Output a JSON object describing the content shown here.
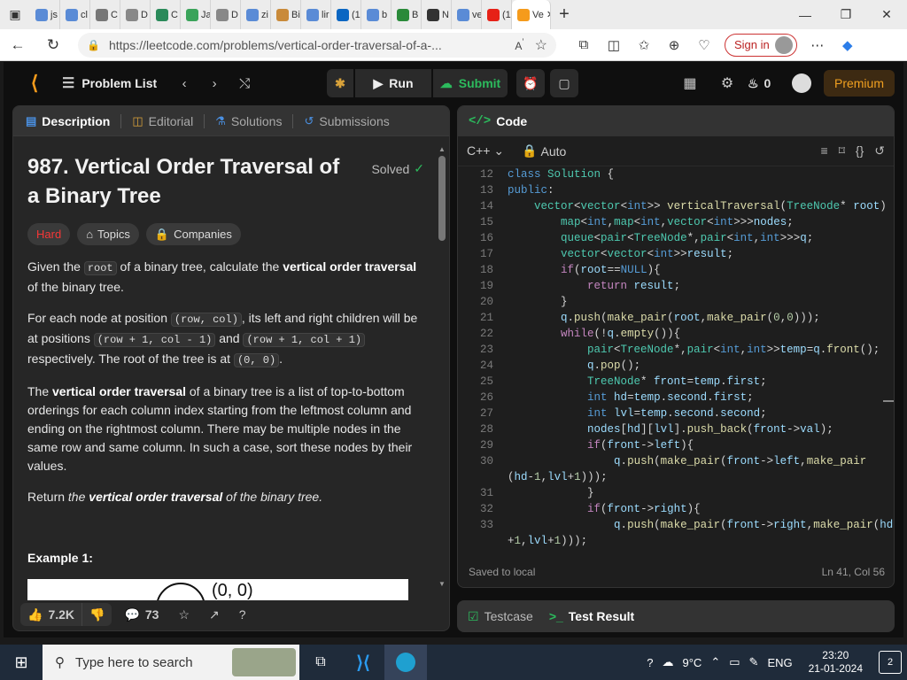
{
  "browser": {
    "tabs": [
      {
        "label": "js",
        "color": "#5a8bd6"
      },
      {
        "label": "cl",
        "color": "#5a8bd6"
      },
      {
        "label": "C",
        "color": "#777777"
      },
      {
        "label": "D",
        "color": "#888888"
      },
      {
        "label": "C",
        "color": "#2a8a5a"
      },
      {
        "label": "Ja",
        "color": "#3aa35a"
      },
      {
        "label": "D",
        "color": "#888888"
      },
      {
        "label": "zi",
        "color": "#5a8bd6"
      },
      {
        "label": "Bi",
        "color": "#c98a3a"
      },
      {
        "label": "lir",
        "color": "#5a8bd6"
      },
      {
        "label": "(1",
        "color": "#0a66c2"
      },
      {
        "label": "b",
        "color": "#5a8bd6"
      },
      {
        "label": "B",
        "color": "#2a8a3a"
      },
      {
        "label": "N",
        "color": "#333333"
      },
      {
        "label": "ve",
        "color": "#5a8bd6"
      },
      {
        "label": "(1",
        "color": "#e62117"
      },
      {
        "label": "Ve",
        "color": "#f59b1c",
        "active": true
      }
    ],
    "url": "https://leetcode.com/problems/vertical-order-traversal-of-a-...",
    "sign_in_label": "Sign in"
  },
  "header": {
    "problem_list_label": "Problem List",
    "run_label": "Run",
    "submit_label": "Submit",
    "streak_count": "0",
    "premium_label": "Premium"
  },
  "left_panel": {
    "tabs": [
      {
        "label": "Description"
      },
      {
        "label": "Editorial"
      },
      {
        "label": "Solutions"
      },
      {
        "label": "Submissions"
      }
    ],
    "title": "987. Vertical Order Traversal of a Binary Tree",
    "solved_label": "Solved",
    "tags": {
      "difficulty": "Hard",
      "topics": "Topics",
      "companies": "Companies"
    },
    "p1": {
      "a": "Given the ",
      "code": "root",
      "b": " of a binary tree, calculate the ",
      "bold": "vertical order traversal",
      "c": " of the binary tree."
    },
    "p2": {
      "a": "For each node at position ",
      "code1": "(row, col)",
      "b": ", its left and right children will be at positions ",
      "code2": "(row + 1, col - 1)",
      "c": " and ",
      "code3": "(row + 1, col + 1)",
      "d": " respectively. The root of the tree is at ",
      "code4": "(0, 0)",
      "e": "."
    },
    "p3": {
      "a": "The ",
      "bold": "vertical order traversal",
      "b": " of a binary tree is a list of top-to-bottom orderings for each column index starting from the leftmost column and ending on the rightmost column. There may be multiple nodes in the same row and same column. In such a case, sort these nodes by their values."
    },
    "p4": {
      "a": "Return ",
      "i1": "the ",
      "bi": "vertical order traversal",
      "i2": " of the binary tree."
    },
    "example_heading": "Example 1:",
    "example_image_label": "(0, 0)",
    "footer": {
      "likes": "7.2K",
      "comments": "73"
    }
  },
  "right_panel": {
    "title": "Code",
    "language": "C++",
    "mode": "Auto",
    "status": "Saved to local",
    "cursor": "Ln 41, Col 56",
    "code_lines": [
      {
        "no": "12",
        "html": "<span class=\"kw\">class</span> <span class=\"ty\">Solution</span> {"
      },
      {
        "no": "13",
        "html": "<span class=\"kw\">public</span>:"
      },
      {
        "no": "14",
        "html": "    <span class=\"ty\">vector</span>&lt;<span class=\"ty\">vector</span>&lt;<span class=\"kw\">int</span>&gt;&gt; <span class=\"fn\">verticalTraversal</span>(<span class=\"ty\">TreeNode</span>* <span class=\"id\">root</span>) {"
      },
      {
        "no": "15",
        "html": "        <span class=\"ty\">map</span>&lt;<span class=\"kw\">int</span>,<span class=\"ty\">map</span>&lt;<span class=\"kw\">int</span>,<span class=\"ty\">vector</span>&lt;<span class=\"kw\">int</span>&gt;&gt;&gt;<span class=\"id\">nodes</span>;"
      },
      {
        "no": "16",
        "html": "        <span class=\"ty\">queue</span>&lt;<span class=\"ty\">pair</span>&lt;<span class=\"ty\">TreeNode</span>*,<span class=\"ty\">pair</span>&lt;<span class=\"kw\">int</span>,<span class=\"kw\">int</span>&gt;&gt;&gt;<span class=\"id\">q</span>;"
      },
      {
        "no": "17",
        "html": "        <span class=\"ty\">vector</span>&lt;<span class=\"ty\">vector</span>&lt;<span class=\"kw\">int</span>&gt;&gt;<span class=\"id\">result</span>;"
      },
      {
        "no": "18",
        "html": "        <span class=\"ct\">if</span>(<span class=\"id\">root</span>==<span class=\"kw\">NULL</span>){"
      },
      {
        "no": "19",
        "html": "            <span class=\"ct\">return</span> <span class=\"id\">result</span>;"
      },
      {
        "no": "20",
        "html": "        }"
      },
      {
        "no": "21",
        "html": "        <span class=\"id\">q</span>.<span class=\"fn\">push</span>(<span class=\"fn\">make_pair</span>(<span class=\"id\">root</span>,<span class=\"fn\">make_pair</span>(<span class=\"nm\">0</span>,<span class=\"nm\">0</span>)));"
      },
      {
        "no": "22",
        "html": "        <span class=\"ct\">while</span>(!<span class=\"id\">q</span>.<span class=\"fn\">empty</span>()){"
      },
      {
        "no": "23",
        "html": "            <span class=\"ty\">pair</span>&lt;<span class=\"ty\">TreeNode</span>*,<span class=\"ty\">pair</span>&lt;<span class=\"kw\">int</span>,<span class=\"kw\">int</span>&gt;&gt;<span class=\"id\">temp</span>=<span class=\"id\">q</span>.<span class=\"fn\">front</span>();"
      },
      {
        "no": "24",
        "html": "            <span class=\"id\">q</span>.<span class=\"fn\">pop</span>();"
      },
      {
        "no": "25",
        "html": "            <span class=\"ty\">TreeNode</span>* <span class=\"id\">front</span>=<span class=\"id\">temp</span>.<span class=\"id\">first</span>;"
      },
      {
        "no": "26",
        "html": "            <span class=\"kw\">int</span> <span class=\"id\">hd</span>=<span class=\"id\">temp</span>.<span class=\"id\">second</span>.<span class=\"id\">first</span>;"
      },
      {
        "no": "27",
        "html": "            <span class=\"kw\">int</span> <span class=\"id\">lvl</span>=<span class=\"id\">temp</span>.<span class=\"id\">second</span>.<span class=\"id\">second</span>;"
      },
      {
        "no": "28",
        "html": "            <span class=\"id\">nodes</span>[<span class=\"id\">hd</span>][<span class=\"id\">lvl</span>].<span class=\"fn\">push_back</span>(<span class=\"id\">front</span>-&gt;<span class=\"id\">val</span>);"
      },
      {
        "no": "29",
        "html": "            <span class=\"ct\">if</span>(<span class=\"id\">front</span>-&gt;<span class=\"id\">left</span>){"
      },
      {
        "no": "30",
        "html": "                <span class=\"id\">q</span>.<span class=\"fn\">push</span>(<span class=\"fn\">make_pair</span>(<span class=\"id\">front</span>-&gt;<span class=\"id\">left</span>,<span class=\"fn\">make_pair</span>"
      },
      {
        "no": "",
        "html": "(<span class=\"id\">hd</span>-<span class=\"nm\">1</span>,<span class=\"id\">lvl</span>+<span class=\"nm\">1</span>)));"
      },
      {
        "no": "31",
        "html": "            }"
      },
      {
        "no": "32",
        "html": "            <span class=\"ct\">if</span>(<span class=\"id\">front</span>-&gt;<span class=\"id\">right</span>){"
      },
      {
        "no": "33",
        "html": "                <span class=\"id\">q</span>.<span class=\"fn\">push</span>(<span class=\"fn\">make_pair</span>(<span class=\"id\">front</span>-&gt;<span class=\"id\">right</span>,<span class=\"fn\">make_pair</span>(<span class=\"id\">hd</span>"
      },
      {
        "no": "",
        "html": "+<span class=\"nm\">1</span>,<span class=\"id\">lvl</span>+<span class=\"nm\">1</span>)));"
      }
    ]
  },
  "bottom_panel": {
    "testcase_label": "Testcase",
    "result_label": "Test Result"
  },
  "taskbar": {
    "search_placeholder": "Type here to search",
    "weather": "9°C",
    "lang": "ENG",
    "time": "23:20",
    "date": "21-01-2024",
    "notifications": "2"
  }
}
